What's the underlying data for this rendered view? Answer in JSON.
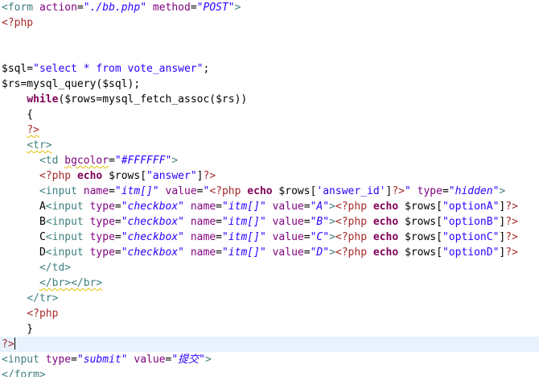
{
  "editor": {
    "colors": {
      "background": "#ffffff",
      "current_line": "#e8f2fe",
      "tag": "#3f7f7f",
      "attribute": "#7f007f",
      "string": "#2a00ff",
      "php_delimiter": "#a52a2a",
      "keyword": "#7f0055",
      "warning_underline": "#e0c000"
    },
    "current_line_index": 22,
    "lines": [
      [
        [
          "tag",
          "<form "
        ],
        [
          "attr",
          "action"
        ],
        [
          "plain",
          "="
        ],
        [
          "stri",
          "\"./bb.php\""
        ],
        [
          "plain",
          " "
        ],
        [
          "attr",
          "method"
        ],
        [
          "plain",
          "="
        ],
        [
          "stri",
          "\"POST\""
        ],
        [
          "tag",
          ">"
        ]
      ],
      [
        [
          "php",
          "<?php"
        ]
      ],
      [],
      [],
      [
        [
          "plain",
          "$sql="
        ],
        [
          "str",
          "\"select * from vote_answer\""
        ],
        [
          "plain",
          ";"
        ]
      ],
      [
        [
          "plain",
          "$rs=mysql_query($sql);"
        ]
      ],
      [
        [
          "plain",
          "    "
        ],
        [
          "kw",
          "while"
        ],
        [
          "plain",
          "($rows=mysql_fetch_assoc($rs))"
        ]
      ],
      [
        [
          "plain",
          "    {"
        ]
      ],
      [
        [
          "plain",
          "    "
        ],
        [
          "php",
          "?>",
          "warn"
        ]
      ],
      [
        [
          "plain",
          "    "
        ],
        [
          "tag",
          "<tr>",
          "warn"
        ]
      ],
      [
        [
          "plain",
          "      "
        ],
        [
          "tag",
          "<td "
        ],
        [
          "attr",
          "bgcolor",
          "warn"
        ],
        [
          "plain",
          "="
        ],
        [
          "stri",
          "\"#FFFFFF\""
        ],
        [
          "tag",
          ">"
        ]
      ],
      [
        [
          "plain",
          "      "
        ],
        [
          "php",
          "<?php"
        ],
        [
          "plain",
          " "
        ],
        [
          "kw",
          "echo"
        ],
        [
          "plain",
          " $rows["
        ],
        [
          "str",
          "\"answer\""
        ],
        [
          "plain",
          "]"
        ],
        [
          "php",
          "?>"
        ]
      ],
      [
        [
          "plain",
          "      "
        ],
        [
          "tag",
          "<input "
        ],
        [
          "attr",
          "name"
        ],
        [
          "plain",
          "="
        ],
        [
          "stri",
          "\"itm[]\""
        ],
        [
          "plain",
          " "
        ],
        [
          "attr",
          "value"
        ],
        [
          "plain",
          "="
        ],
        [
          "str",
          "\""
        ],
        [
          "php",
          "<?php"
        ],
        [
          "plain",
          " "
        ],
        [
          "kw",
          "echo"
        ],
        [
          "plain",
          " $rows["
        ],
        [
          "str",
          "'answer_id'"
        ],
        [
          "plain",
          "]"
        ],
        [
          "php",
          "?>"
        ],
        [
          "str",
          "\""
        ],
        [
          "plain",
          " "
        ],
        [
          "attr",
          "type"
        ],
        [
          "plain",
          "="
        ],
        [
          "stri",
          "\"hidden\""
        ],
        [
          "tag",
          ">"
        ]
      ],
      [
        [
          "plain",
          "      A"
        ],
        [
          "tag",
          "<input "
        ],
        [
          "attr",
          "type"
        ],
        [
          "plain",
          "="
        ],
        [
          "stri",
          "\"checkbox\""
        ],
        [
          "plain",
          " "
        ],
        [
          "attr",
          "name"
        ],
        [
          "plain",
          "="
        ],
        [
          "stri",
          "\"itm[]\""
        ],
        [
          "plain",
          " "
        ],
        [
          "attr",
          "value"
        ],
        [
          "plain",
          "="
        ],
        [
          "stri",
          "\"A\""
        ],
        [
          "tag",
          ">"
        ],
        [
          "php",
          "<?php"
        ],
        [
          "plain",
          " "
        ],
        [
          "kw",
          "echo"
        ],
        [
          "plain",
          " $rows["
        ],
        [
          "str",
          "\"optionA\""
        ],
        [
          "plain",
          "]"
        ],
        [
          "php",
          "?>"
        ]
      ],
      [
        [
          "plain",
          "      B"
        ],
        [
          "tag",
          "<input "
        ],
        [
          "attr",
          "type"
        ],
        [
          "plain",
          "="
        ],
        [
          "stri",
          "\"checkbox\""
        ],
        [
          "plain",
          " "
        ],
        [
          "attr",
          "name"
        ],
        [
          "plain",
          "="
        ],
        [
          "stri",
          "\"itm[]\""
        ],
        [
          "plain",
          " "
        ],
        [
          "attr",
          "value"
        ],
        [
          "plain",
          "="
        ],
        [
          "stri",
          "\"B\""
        ],
        [
          "tag",
          ">"
        ],
        [
          "php",
          "<?php"
        ],
        [
          "plain",
          " "
        ],
        [
          "kw",
          "echo"
        ],
        [
          "plain",
          " $rows["
        ],
        [
          "str",
          "\"optionB\""
        ],
        [
          "plain",
          "]"
        ],
        [
          "php",
          "?>"
        ]
      ],
      [
        [
          "plain",
          "      C"
        ],
        [
          "tag",
          "<input "
        ],
        [
          "attr",
          "type"
        ],
        [
          "plain",
          "="
        ],
        [
          "stri",
          "\"checkbox\""
        ],
        [
          "plain",
          " "
        ],
        [
          "attr",
          "name"
        ],
        [
          "plain",
          "="
        ],
        [
          "stri",
          "\"itm[]\""
        ],
        [
          "plain",
          " "
        ],
        [
          "attr",
          "value"
        ],
        [
          "plain",
          "="
        ],
        [
          "stri",
          "\"C\""
        ],
        [
          "tag",
          ">"
        ],
        [
          "php",
          "<?php"
        ],
        [
          "plain",
          " "
        ],
        [
          "kw",
          "echo"
        ],
        [
          "plain",
          " $rows["
        ],
        [
          "str",
          "\"optionC\""
        ],
        [
          "plain",
          "]"
        ],
        [
          "php",
          "?>"
        ]
      ],
      [
        [
          "plain",
          "      D"
        ],
        [
          "tag",
          "<input "
        ],
        [
          "attr",
          "type"
        ],
        [
          "plain",
          "="
        ],
        [
          "stri",
          "\"checkbox\""
        ],
        [
          "plain",
          " "
        ],
        [
          "attr",
          "name"
        ],
        [
          "plain",
          "="
        ],
        [
          "stri",
          "\"itm[]\""
        ],
        [
          "plain",
          " "
        ],
        [
          "attr",
          "value"
        ],
        [
          "plain",
          "="
        ],
        [
          "stri",
          "\"D\""
        ],
        [
          "tag",
          ">"
        ],
        [
          "php",
          "<?php"
        ],
        [
          "plain",
          " "
        ],
        [
          "kw",
          "echo"
        ],
        [
          "plain",
          " $rows["
        ],
        [
          "str",
          "\"optionD\""
        ],
        [
          "plain",
          "]"
        ],
        [
          "php",
          "?>"
        ]
      ],
      [
        [
          "plain",
          "      "
        ],
        [
          "tag",
          "</td>"
        ]
      ],
      [
        [
          "plain",
          "      "
        ],
        [
          "tag",
          "</br></br>",
          "warn"
        ]
      ],
      [
        [
          "plain",
          "    "
        ],
        [
          "tag",
          "</tr>"
        ]
      ],
      [
        [
          "plain",
          "    "
        ],
        [
          "php",
          "<?php"
        ]
      ],
      [
        [
          "plain",
          "    }"
        ]
      ],
      [
        [
          "php",
          "?>"
        ]
      ],
      [
        [
          "tag",
          "<input "
        ],
        [
          "attr",
          "type"
        ],
        [
          "plain",
          "="
        ],
        [
          "stri",
          "\"submit\""
        ],
        [
          "plain",
          " "
        ],
        [
          "attr",
          "value"
        ],
        [
          "plain",
          "="
        ],
        [
          "stri",
          "\"提交\""
        ],
        [
          "tag",
          ">"
        ]
      ],
      [
        [
          "tag",
          "</form>"
        ]
      ]
    ]
  }
}
